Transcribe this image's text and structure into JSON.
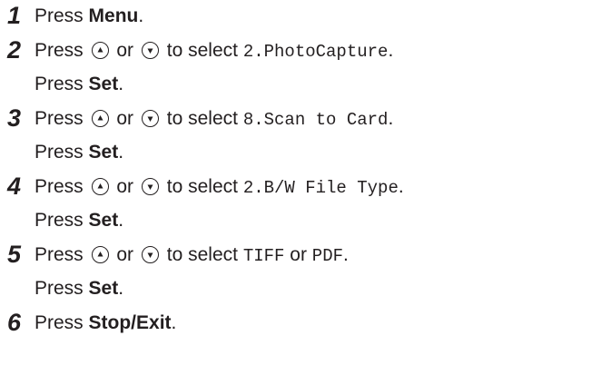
{
  "steps": [
    {
      "number": "1",
      "line1": {
        "press": "Press",
        "key": "Menu",
        "end": "."
      }
    },
    {
      "number": "2",
      "line1": {
        "press": "Press",
        "or": "or",
        "to_select": "to select",
        "value": "2.PhotoCapture",
        "end": "."
      },
      "line2": {
        "press": "Press",
        "key": "Set",
        "end": "."
      }
    },
    {
      "number": "3",
      "line1": {
        "press": "Press",
        "or": "or",
        "to_select": "to select",
        "value": "8.Scan to Card",
        "end": "."
      },
      "line2": {
        "press": "Press",
        "key": "Set",
        "end": "."
      }
    },
    {
      "number": "4",
      "line1": {
        "press": "Press",
        "or": "or",
        "to_select": "to select",
        "value": "2.B/W File Type",
        "end": "."
      },
      "line2": {
        "press": "Press",
        "key": "Set",
        "end": "."
      }
    },
    {
      "number": "5",
      "line1": {
        "press": "Press",
        "or": "or",
        "to_select": "to select",
        "value_a": "TIFF",
        "or2": "or",
        "value_b": "PDF",
        "end": "."
      },
      "line2": {
        "press": "Press",
        "key": "Set",
        "end": "."
      }
    },
    {
      "number": "6",
      "line1": {
        "press": "Press",
        "key": "Stop/Exit",
        "end": "."
      }
    }
  ],
  "icons": {
    "up": "up-arrow-button-icon",
    "down": "down-arrow-button-icon"
  },
  "colors": {
    "text": "#231f20"
  }
}
